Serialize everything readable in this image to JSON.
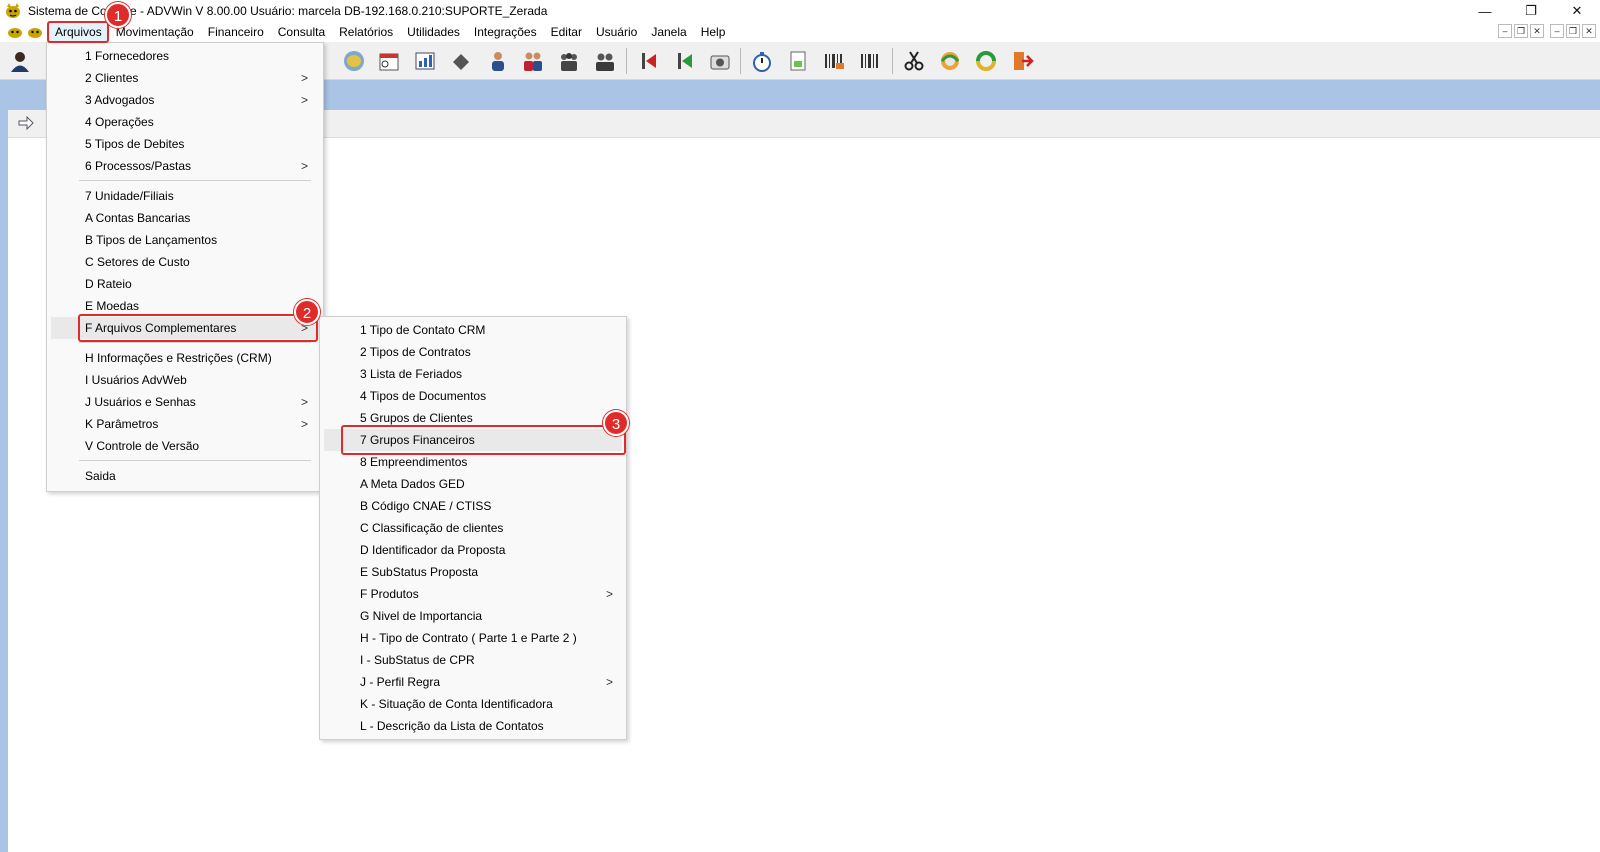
{
  "window": {
    "title": "Sistema de Controle - ADVWin  V 8.00.00  Usuário: marcela  DB-192.168.0.210:SUPORTE_Zerada",
    "minimize": "—",
    "restore": "❐",
    "close": "✕"
  },
  "menubar": {
    "items": [
      "Arquivos",
      "Movimentação",
      "Financeiro",
      "Consulta",
      "Relatórios",
      "Utilidades",
      "Integrações",
      "Editar",
      "Usuário",
      "Janela",
      "Help"
    ],
    "mdi_controls": [
      "–",
      "❐",
      "✕",
      "–",
      "❐",
      "✕"
    ]
  },
  "arquivos_menu": {
    "group1": [
      "1 Fornecedores",
      "2 Clientes",
      "3 Advogados",
      "4 Operações",
      "5 Tipos de Debites",
      "6 Processos/Pastas"
    ],
    "group2": [
      "7 Unidade/Filiais",
      "A Contas Bancarias",
      "B Tipos de Lançamentos",
      "C Setores de Custo",
      "D Rateio",
      "E Moedas",
      "F Arquivos Complementares"
    ],
    "group3": [
      "H Informações e Restrições (CRM)",
      "I Usuários AdvWeb",
      "J Usuários e Senhas",
      "K Parâmetros",
      "V Controle de Versão"
    ],
    "group4": [
      "Saida"
    ],
    "submenu_arrow": ">"
  },
  "complementares_menu": {
    "items": [
      "1 Tipo de Contato CRM",
      "2 Tipos de Contratos",
      "3 Lista de Feriados",
      "4 Tipos de Documentos",
      "5 Grupos de Clientes",
      "7 Grupos Financeiros",
      "8 Empreendimentos",
      "A Meta Dados GED",
      "B Código CNAE / CTISS",
      "C Classificação de clientes",
      "D Identificador da Proposta",
      "E SubStatus Proposta",
      "F Produtos",
      "G Nivel de Importancia",
      "H - Tipo de Contrato ( Parte 1 e Parte 2 )",
      "I - SubStatus de CPR",
      "J - Perfil Regra",
      "K - Situação de Conta Identificadora",
      "L - Descrição da Lista de Contatos"
    ]
  },
  "annotations": [
    "1",
    "2",
    "3"
  ],
  "colors": {
    "annotation": "#e02b2b",
    "blue_band": "#a9c4e5",
    "toolbar_bg": "#f0f0f0",
    "menu_bg": "#f9f9f9"
  },
  "icons": {
    "app": "cat-logo-icon",
    "toolbar": [
      "user-icon",
      "globe-icon",
      "calendar-icon",
      "chart-icon",
      "hand-icon",
      "person-icon",
      "two-people-icon",
      "group-icon",
      "team-icon",
      "arrow-red-icon",
      "arrow-green-icon",
      "camera-icon",
      "stopwatch-icon",
      "document-icon",
      "barcode-icon",
      "barcode-list-icon",
      "scissors-icon",
      "sync-icon",
      "refresh-icon",
      "exit-icon"
    ]
  }
}
